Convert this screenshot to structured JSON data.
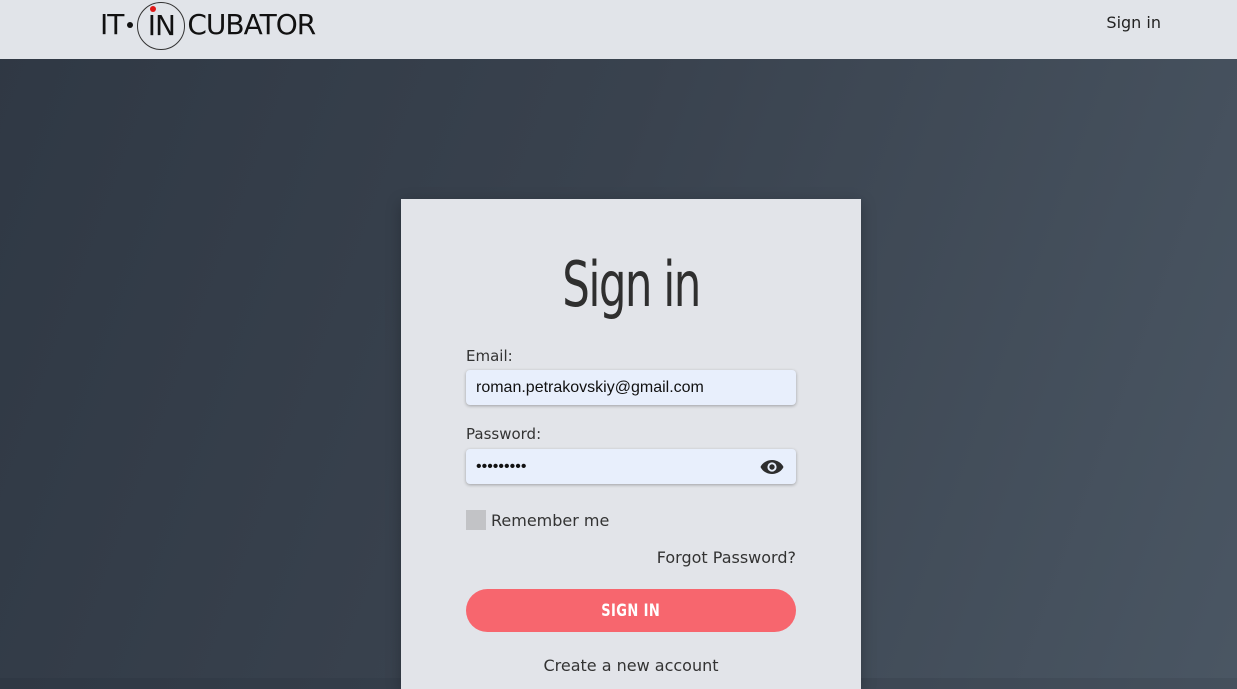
{
  "header": {
    "logo_left": "IT",
    "logo_circle": "IN",
    "logo_right": "CUBATOR",
    "signin_link": "Sign in"
  },
  "form": {
    "title": "Sign in",
    "email_label": "Email:",
    "email_value": "roman.petrakovskiy@gmail.com",
    "password_label": "Password:",
    "password_value": "•••••••••",
    "password_icon": "eye-icon",
    "remember_label": "Remember me",
    "remember_checked": false,
    "forgot_link": "Forgot Password?",
    "submit_label": "SIGN IN",
    "create_link": "Create a new account"
  },
  "colors": {
    "accent": "#f7666e",
    "header_bg": "#e1e4e9",
    "card_bg": "#e2e4e9",
    "input_bg": "#e8effc",
    "logo_dot": "#e01818"
  }
}
